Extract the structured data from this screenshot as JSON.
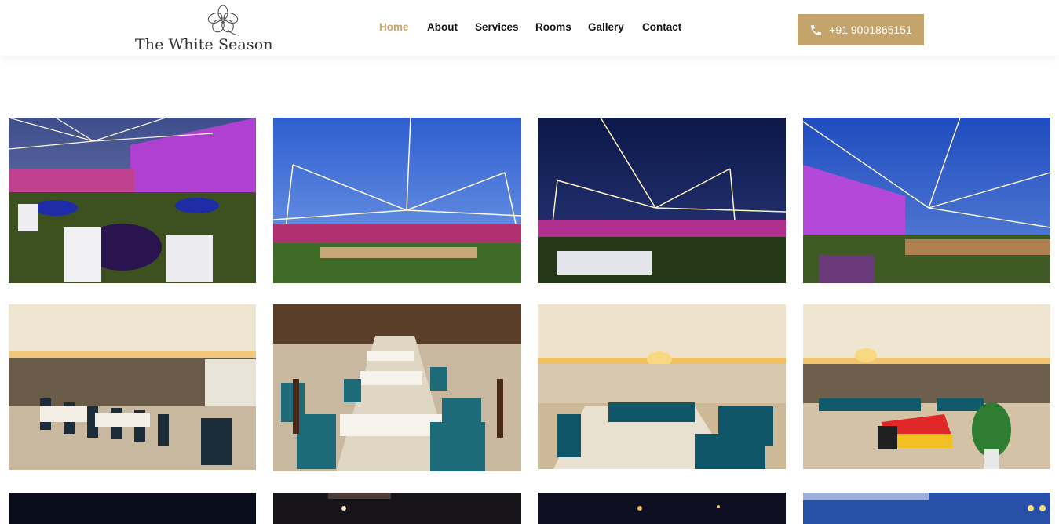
{
  "brand": {
    "name": "The White Season"
  },
  "nav": {
    "items": [
      {
        "label": "Home",
        "active": true
      },
      {
        "label": "About"
      },
      {
        "label": "Services"
      },
      {
        "label": "Rooms"
      },
      {
        "label": "Gallery"
      },
      {
        "label": "Contact"
      }
    ]
  },
  "call_button": {
    "label": "+91 9001865151",
    "icon": "phone-icon"
  },
  "colors": {
    "accent": "#c4a46a",
    "active_nav": "#c7a46b"
  },
  "gallery": {
    "photos": [
      {
        "subject": "outdoor lawn party with purple lit building at night"
      },
      {
        "subject": "outdoor lawn with light strands under blue sky"
      },
      {
        "subject": "night lawn with light strands"
      },
      {
        "subject": "purple lit building with light strands"
      },
      {
        "subject": "banquet hall with dining tables"
      },
      {
        "subject": "restaurant dining tables with teal chairs"
      },
      {
        "subject": "banquet hall with chandeliers"
      },
      {
        "subject": "banquet hall with red stage"
      },
      {
        "subject": "night scene"
      },
      {
        "subject": "dark indoor ceiling lights"
      },
      {
        "subject": "night scene with lights"
      },
      {
        "subject": "building at dusk"
      }
    ]
  }
}
